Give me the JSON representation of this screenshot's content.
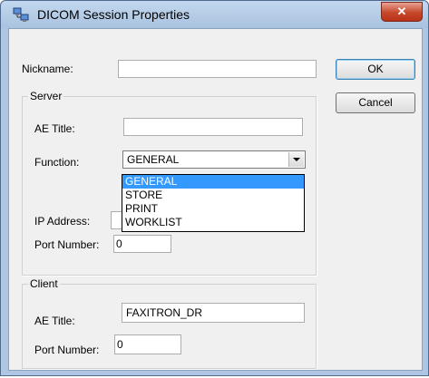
{
  "window": {
    "title": "DICOM Session Properties",
    "close_label": "✕"
  },
  "form": {
    "nickname_label": "Nickname:",
    "nickname_value": "",
    "ok_label": "OK",
    "cancel_label": "Cancel"
  },
  "server": {
    "group_label": "Server",
    "ae_title_label": "AE Title:",
    "ae_title_value": "",
    "function_label": "Function:",
    "function_value": "GENERAL",
    "function_options": [
      "GENERAL",
      "STORE",
      "PRINT",
      "WORKLIST"
    ],
    "ip_address_label": "IP Address:",
    "port_label": "Port Number:",
    "port_value": "0"
  },
  "client": {
    "group_label": "Client",
    "ae_title_label": "AE Title:",
    "ae_title_value": "FAXITRON_DR",
    "port_label": "Port Number:",
    "port_value": "0"
  }
}
